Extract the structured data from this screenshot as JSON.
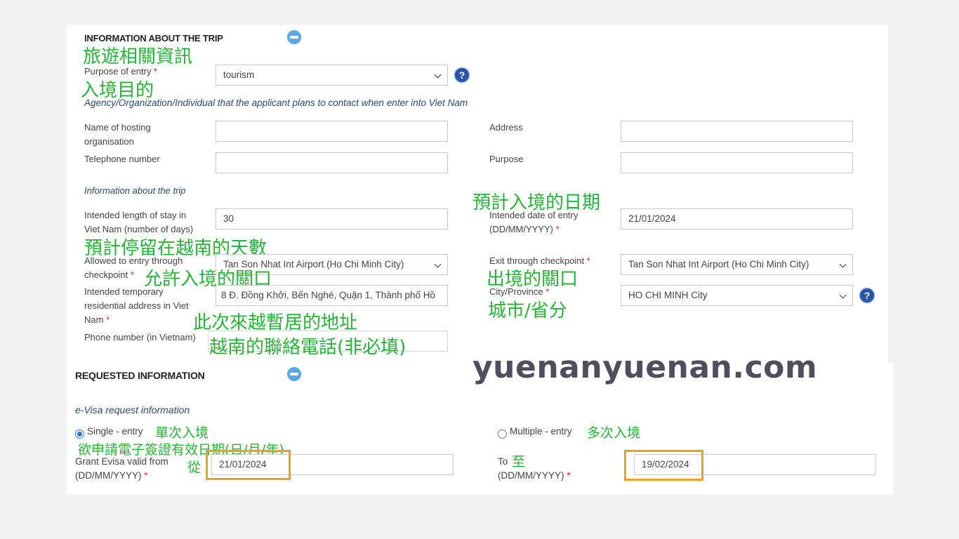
{
  "trip_section": {
    "title": "INFORMATION ABOUT THE TRIP",
    "title_cn": "旅遊相關資訊",
    "purpose_label": "Purpose of entry",
    "purpose_cn": "入境目的",
    "purpose_value": "tourism",
    "agency_heading": "Agency/Organization/Individual that the applicant plans to contact when enter into Viet Nam",
    "hosting_label_1": "Name of hosting",
    "hosting_label_2": "organisation",
    "hosting_value": "",
    "address_label": "Address",
    "address_value": "",
    "telephone_label": "Telephone number",
    "telephone_value": "",
    "purpose2_label": "Purpose",
    "purpose2_value": "",
    "info_heading": "Information about the trip",
    "stay_label_1": "Intended length of stay in",
    "stay_label_2": "Viet Nam (number of days)",
    "stay_value": "30",
    "stay_cn": "預計停留在越南的天數",
    "entry_date_cn": "預計入境的日期",
    "entry_date_label_1": "Intended date of entry",
    "entry_date_label_2": "(DD/MM/YYYY)",
    "entry_date_value": "21/01/2024",
    "allowed_label_1": "Allowed to entry through",
    "allowed_label_2": "checkpoint",
    "allowed_value": "Tan Son Nhat Int Airport (Ho Chi Minh City)",
    "allowed_cn": "允許入境的關口",
    "exit_label": "Exit through checkpoint",
    "exit_value": "Tan Son Nhat Int Airport (Ho Chi Minh City)",
    "exit_cn": "出境的關口",
    "temp_addr_label_1": "Intended temporary",
    "temp_addr_label_2": "residential address in Viet",
    "temp_addr_label_3": "Nam",
    "temp_addr_value": "8 Đ. Đồng Khởi, Bến Nghé, Quận 1, Thành phố Hồ",
    "temp_addr_cn": "此次來越暫居的地址",
    "city_label": "City/Province",
    "city_value": "HO CHI MINH City",
    "city_cn": "城市/省分",
    "phone_label": "Phone number (in Vietnam)",
    "phone_cn": "越南的聯絡電話(非必填)",
    "required_mark": "*",
    "help_symbol": "?"
  },
  "requested_section": {
    "title": "REQUESTED INFORMATION",
    "evisa_heading": "e-Visa request information",
    "single_label": "Single - entry",
    "single_cn": "單次入境",
    "multiple_label": "Multiple - entry",
    "multiple_cn": "多次入境",
    "valid_cn": "欲申請電子簽證有效日期(日/月/年)",
    "from_cn": "從",
    "grant_label_1": "Grant Evisa valid from",
    "grant_label_2": "(DD/MM/YYYY)",
    "from_value": "21/01/2024",
    "to_label": "To",
    "to_cn": "至",
    "to_label_2": "(DD/MM/YYYY)",
    "to_value": "19/02/2024",
    "selected_entry": "single"
  },
  "watermark": "yuenanyuenan.com",
  "colors": {
    "annotation_green": "#27b33a",
    "highlight_orange": "#f0a21c",
    "required_red": "#d9302c",
    "help_blue": "#2a54a6",
    "collapse_blue": "#5aa6e8"
  },
  "icons": [
    "collapse-minus-icon",
    "help-question-icon",
    "chevron-down-icon",
    "radio-icon"
  ]
}
